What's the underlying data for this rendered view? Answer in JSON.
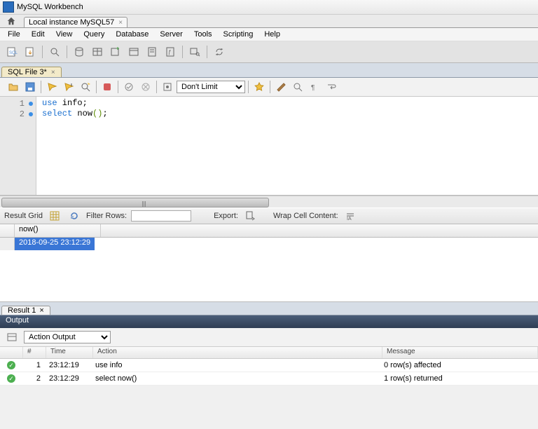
{
  "title": "MySQL Workbench",
  "connection_tab": "Local instance MySQL57",
  "menu": [
    "File",
    "Edit",
    "View",
    "Query",
    "Database",
    "Server",
    "Tools",
    "Scripting",
    "Help"
  ],
  "editor_tab": "SQL File 3*",
  "limit_select": "Don't Limit",
  "code": {
    "line1": {
      "kw": "use",
      "rest": " info;"
    },
    "line2": {
      "kw": "select",
      "fn": " now",
      "paren": "()",
      "semi": ";"
    }
  },
  "result_toolbar": {
    "grid_label": "Result Grid",
    "filter_label": "Filter Rows:",
    "export_label": "Export:",
    "wrap_label": "Wrap Cell Content:"
  },
  "grid_col": "now()",
  "grid_val": "2018-09-25 23:12:29",
  "result_tab": "Result 1",
  "output_header": "Output",
  "output_select": "Action Output",
  "output_cols": {
    "num": "#",
    "time": "Time",
    "action": "Action",
    "message": "Message"
  },
  "output_rows": [
    {
      "num": "1",
      "time": "23:12:19",
      "action": "use info",
      "message": "0 row(s) affected"
    },
    {
      "num": "2",
      "time": "23:12:29",
      "action": "select now()",
      "message": "1 row(s) returned"
    }
  ]
}
